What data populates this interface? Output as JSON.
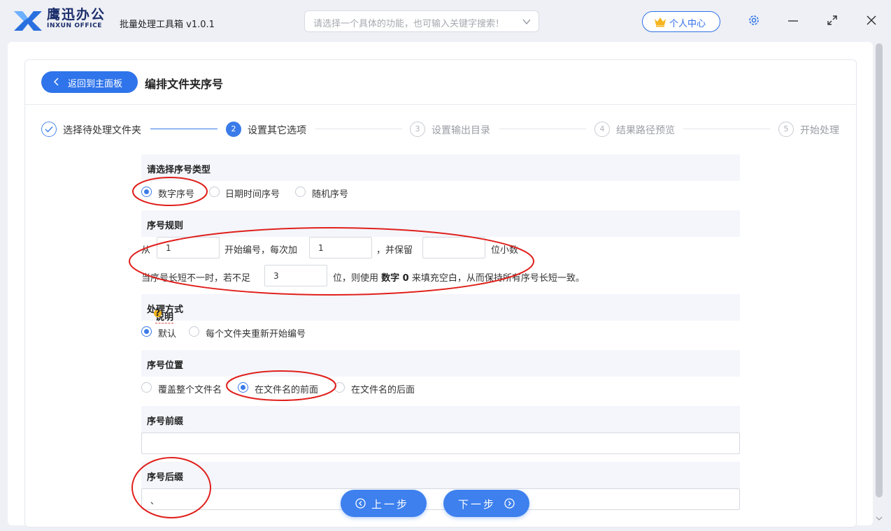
{
  "app": {
    "logo_cn": "鹰迅办公",
    "logo_en": "INXUN OFFICE",
    "title": "批量处理工具箱 v1.0.1",
    "search_placeholder": "请选择一个具体的功能，也可输入关键字搜索！",
    "user_center": "个人中心"
  },
  "header": {
    "back_label": "返回到主面板",
    "page_title": "编排文件夹序号"
  },
  "steps": [
    {
      "num": "✓",
      "label": "选择待处理文件夹",
      "state": "done"
    },
    {
      "num": "2",
      "label": "设置其它选项",
      "state": "active"
    },
    {
      "num": "3",
      "label": "设置输出目录",
      "state": "todo"
    },
    {
      "num": "4",
      "label": "结果路径预览",
      "state": "todo"
    },
    {
      "num": "5",
      "label": "开始处理",
      "state": "todo"
    }
  ],
  "sections": {
    "type": {
      "title": "请选择序号类型",
      "options": [
        "数字序号",
        "日期时间序号",
        "随机序号"
      ],
      "selected": "数字序号"
    },
    "rule": {
      "title": "序号规则",
      "from": "从",
      "start_value": "1",
      "start_text": "开始编号，每次加",
      "step_value": "1",
      "keep_text": "，并保留",
      "decimal_value": "",
      "decimal_text": "位小数",
      "pad_prefix": "当序号长短不一时，若不足",
      "pad_value": "3",
      "pad_mid": "位，则使用",
      "pad_bold": "数字 0",
      "pad_suffix": "来填充空白，从而保持所有序号长短一致。"
    },
    "mode": {
      "title": "处理方式",
      "hint": "说明",
      "help": "?",
      "options": [
        "默认",
        "每个文件夹重新开始编号"
      ],
      "selected": "默认"
    },
    "position": {
      "title": "序号位置",
      "options": [
        "覆盖整个文件名",
        "在文件名的前面",
        "在文件名的后面"
      ],
      "selected": "在文件名的前面"
    },
    "prefix": {
      "title": "序号前缀",
      "value": ""
    },
    "suffix": {
      "title": "序号后缀",
      "value": "、"
    }
  },
  "footer": {
    "prev": "上一步",
    "next": "下一步"
  },
  "colors": {
    "accent": "#2f74ea",
    "annotation": "#e0201c"
  }
}
